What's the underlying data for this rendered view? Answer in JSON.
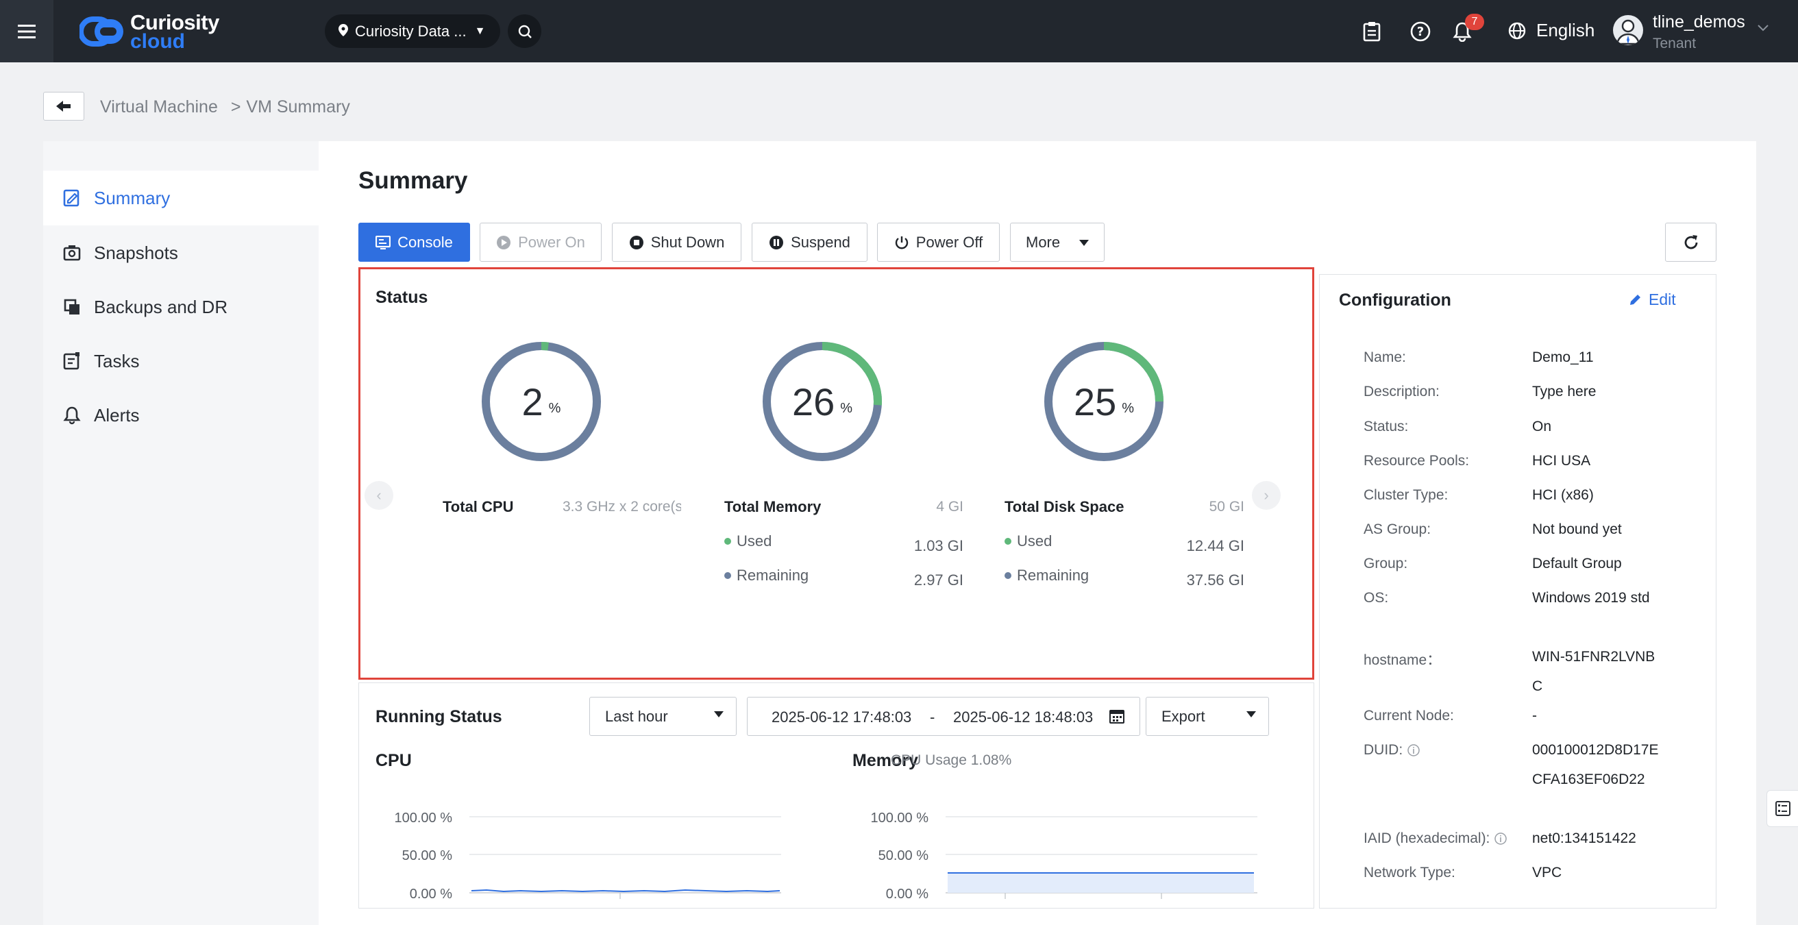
{
  "topbar": {
    "brand_line1": "Curiosity",
    "brand_line2": "cloud",
    "region": "Curiosity Data ...",
    "notification_count": "7",
    "language": "English",
    "user_name": "tline_demos",
    "user_role": "Tenant"
  },
  "breadcrumb": {
    "parent": "Virtual Machine",
    "separator": ">",
    "current": "VM Summary"
  },
  "sidenav": {
    "items": [
      {
        "label": "Summary",
        "icon": "summary-icon",
        "active": true
      },
      {
        "label": "Snapshots",
        "icon": "camera-icon"
      },
      {
        "label": "Backups and DR",
        "icon": "copy-icon"
      },
      {
        "label": "Tasks",
        "icon": "tasks-icon"
      },
      {
        "label": "Alerts",
        "icon": "bell-icon"
      }
    ]
  },
  "page_title": "Summary",
  "toolbar": {
    "console": "Console",
    "power_on": "Power On",
    "shut_down": "Shut Down",
    "suspend": "Suspend",
    "power_off": "Power Off",
    "more": "More"
  },
  "status": {
    "title": "Status",
    "cpu": {
      "value": "2",
      "unit": "%",
      "label": "Total CPU",
      "capacity": "3.3 GHz x 2 core(s",
      "used_fraction": 0.02
    },
    "memory": {
      "value": "26",
      "unit": "%",
      "label": "Total Memory",
      "capacity": "4 GI",
      "used_label": "Used",
      "used": "1.03 GI",
      "remaining_label": "Remaining",
      "remaining": "2.97 GI",
      "used_fraction": 0.26
    },
    "disk": {
      "value": "25",
      "unit": "%",
      "label": "Total Disk Space",
      "capacity": "50 GI",
      "used_label": "Used",
      "used": "12.44 GI",
      "remaining_label": "Remaining",
      "remaining": "37.56 GI",
      "used_fraction": 0.25
    },
    "colors": {
      "used": "#5fb87a",
      "remaining": "#6b7f9e"
    }
  },
  "configuration": {
    "title": "Configuration",
    "edit": "Edit",
    "rows": [
      {
        "label": "Name:",
        "value": "Demo_11"
      },
      {
        "label": "Description:",
        "value": "Type here"
      },
      {
        "label": "Status:",
        "value": "On"
      },
      {
        "label": "Resource Pools:",
        "value": "HCI USA"
      },
      {
        "label": "Cluster Type:",
        "value": "HCI (x86)"
      },
      {
        "label": "AS Group:",
        "value": "Not bound yet"
      },
      {
        "label": "Group:",
        "value": "Default Group"
      },
      {
        "label": "OS:",
        "value": "Windows 2019 std"
      },
      {
        "label": "hostname：",
        "value": "WIN-51FNR2LVNBC"
      },
      {
        "label": "Current Node:",
        "value": "-"
      },
      {
        "label": "DUID:",
        "value": "000100012D8D17ECFA163EF06D22"
      },
      {
        "label": "IAID (hexadecimal):",
        "value": "net0:134151422"
      },
      {
        "label": "Network Type:",
        "value": "VPC"
      }
    ]
  },
  "running_status": {
    "title": "Running Status",
    "range": "Last hour",
    "start": "2025-06-12 17:48:03",
    "dash": "-",
    "end": "2025-06-12 18:48:03",
    "export": "Export",
    "cpu_title": "CPU",
    "memory_title": "Memory",
    "cpu_usage_note": "CPU Usage 1.08%",
    "ticks": [
      "100.00 %",
      "50.00 %",
      "0.00 %"
    ]
  }
}
